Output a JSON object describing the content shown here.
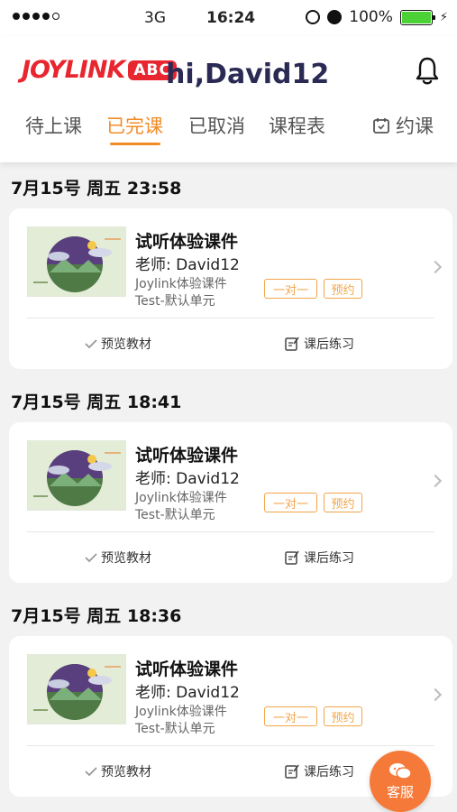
{
  "status_bar": {
    "carrier": "3G",
    "time": "16:24",
    "battery": "100%"
  },
  "header": {
    "logo_text": "JOYLINK",
    "logo_badge": "ABC",
    "greeting": "hi,David12"
  },
  "tabs": {
    "upcoming": "待上课",
    "completed": "已完课",
    "cancelled": "已取消",
    "schedule": "课程表",
    "book": "约课",
    "active": "completed"
  },
  "lessons": [
    {
      "datetime": "7月15号 周五 23:58",
      "title": "试听体验课件",
      "teacher": "老师: David12",
      "course": "Joylink体验课件",
      "unit": "Test-默认单元",
      "type_badge": "一对一",
      "status_badge": "预约",
      "preview_label": "预览教材",
      "homework_label": "课后练习"
    },
    {
      "datetime": "7月15号 周五 18:41",
      "title": "试听体验课件",
      "teacher": "老师: David12",
      "course": "Joylink体验课件",
      "unit": "Test-默认单元",
      "type_badge": "一对一",
      "status_badge": "预约",
      "preview_label": "预览教材",
      "homework_label": "课后练习"
    },
    {
      "datetime": "7月15号 周五 18:36",
      "title": "试听体验课件",
      "teacher": "老师: David12",
      "course": "Joylink体验课件",
      "unit": "Test-默认单元",
      "type_badge": "一对一",
      "status_badge": "预约",
      "preview_label": "预览教材",
      "homework_label": "课后练习"
    }
  ],
  "support_button": {
    "label": "客服"
  },
  "colors": {
    "accent": "#f28c28",
    "brand": "#e8262f",
    "badge": "#f2a54a",
    "fab": "#f57a3a"
  }
}
